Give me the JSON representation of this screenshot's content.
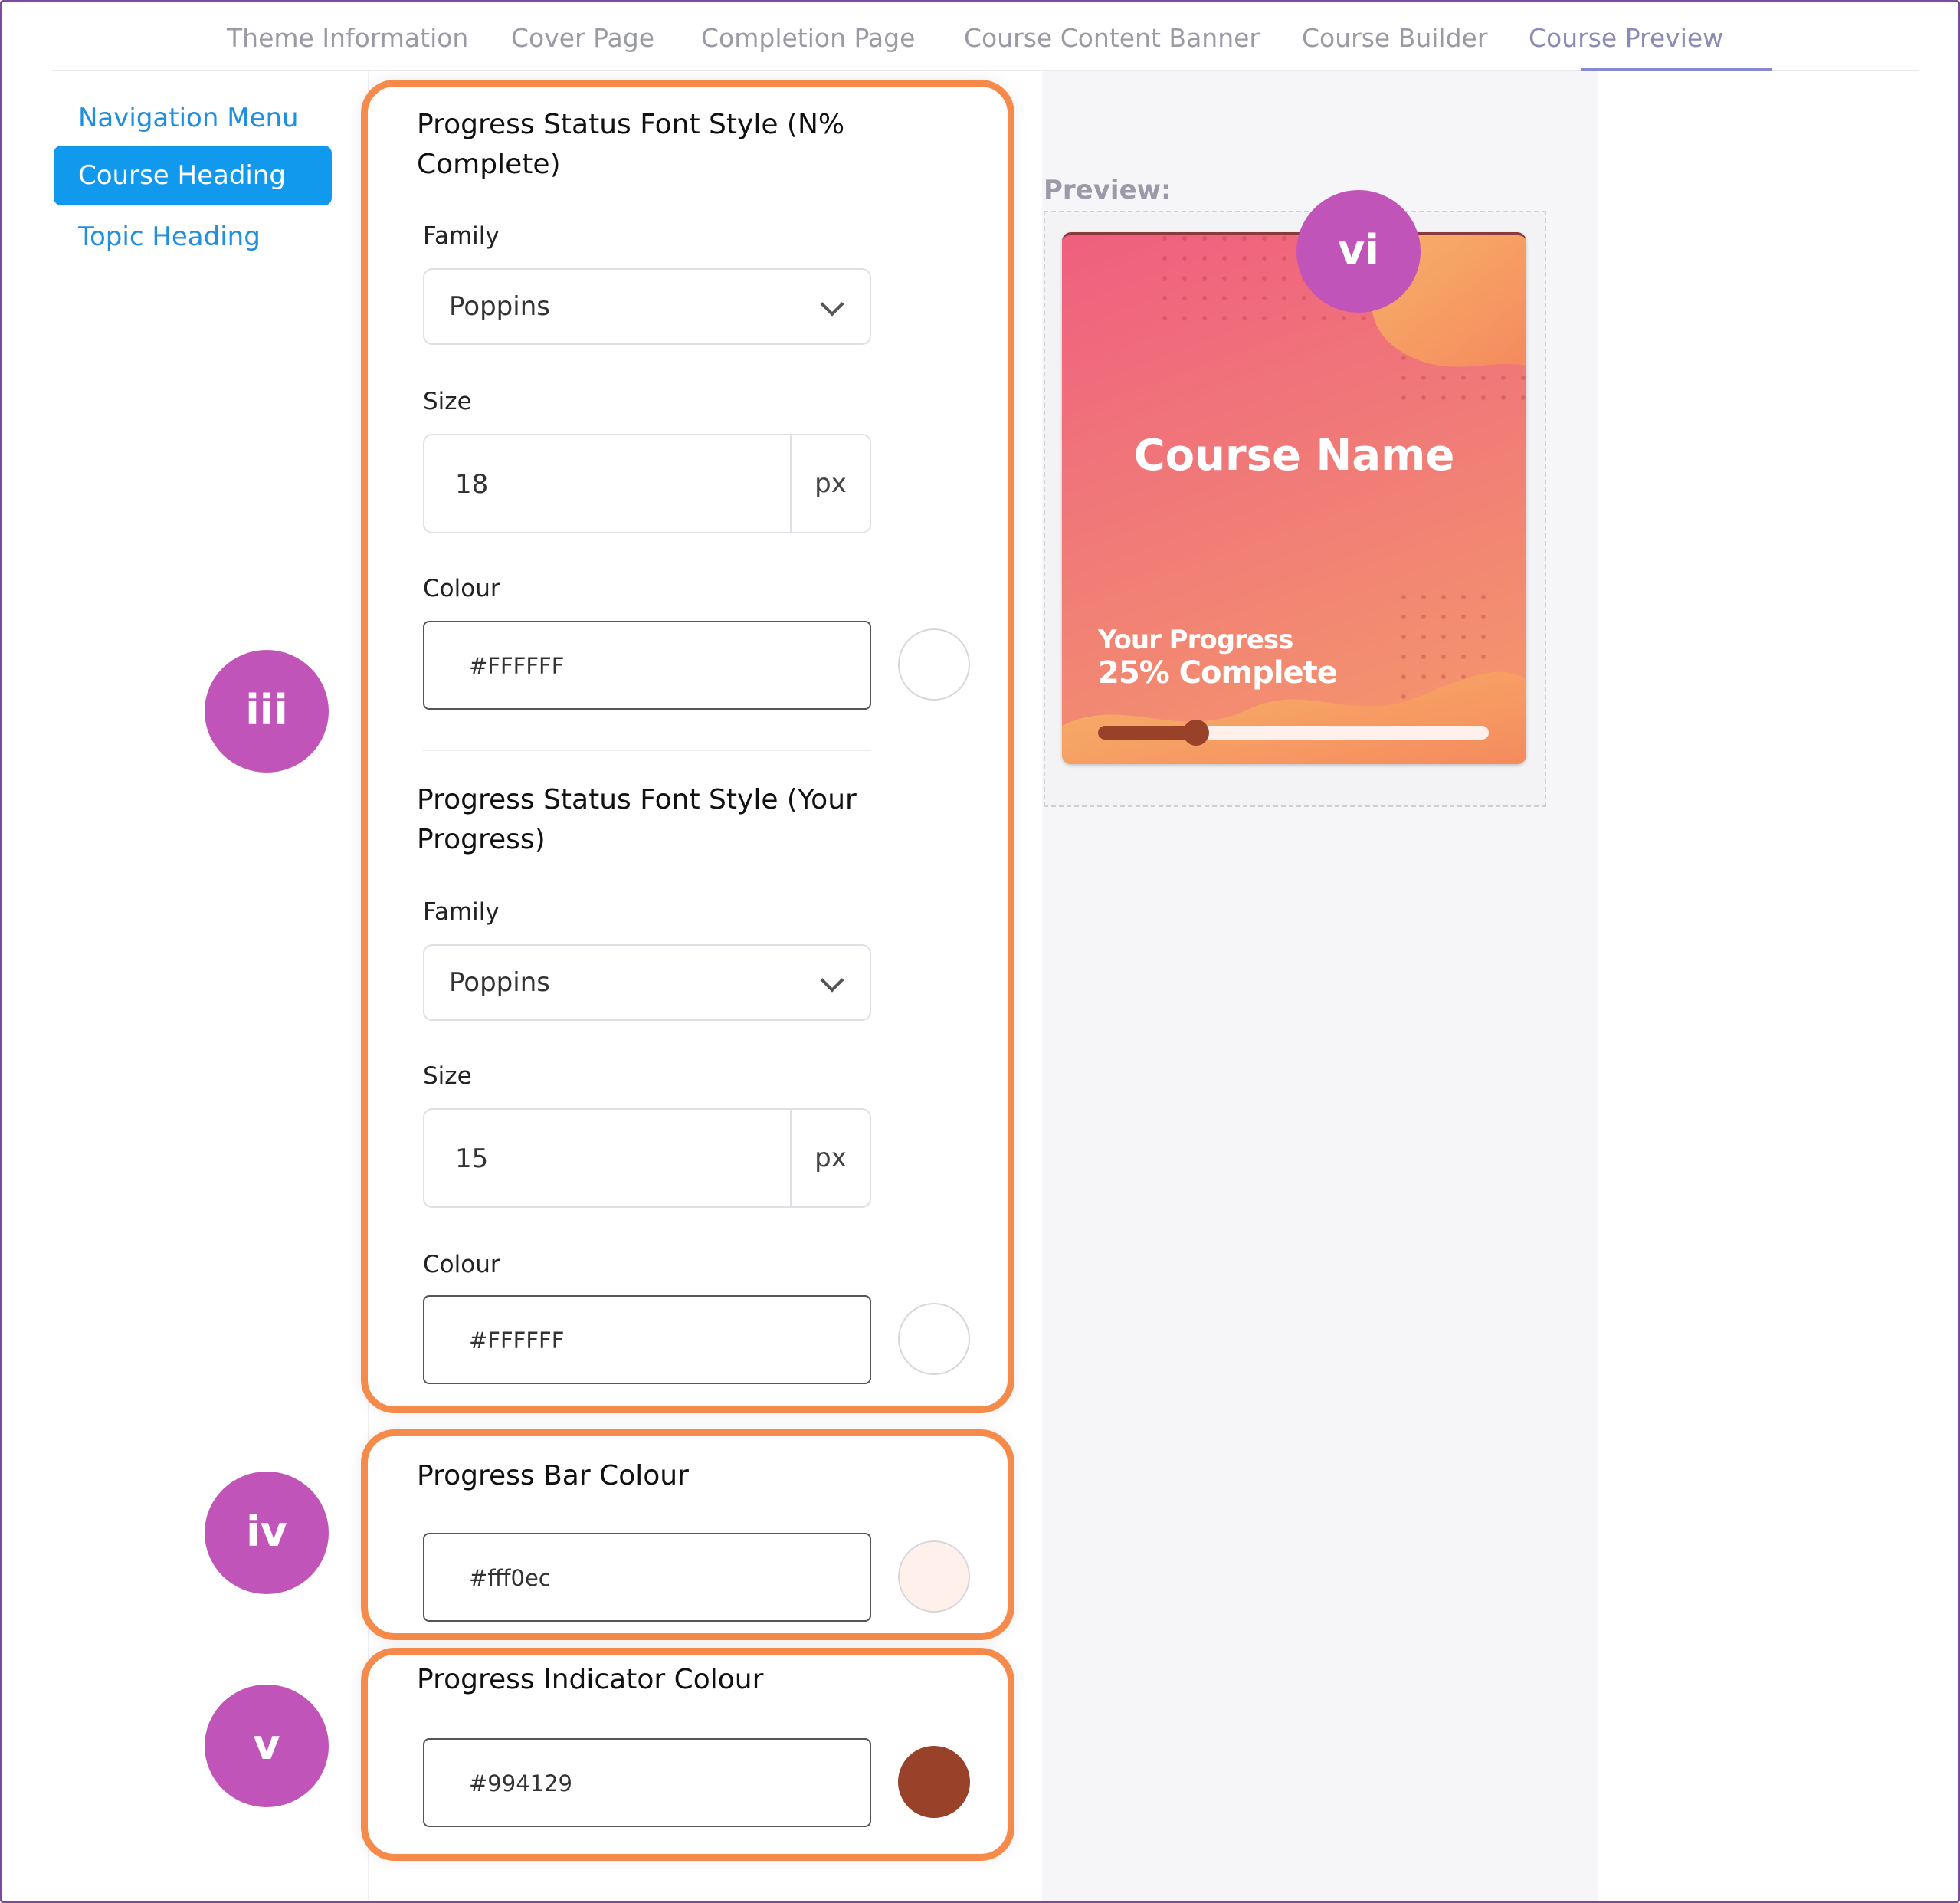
{
  "tabs": [
    {
      "label": "Theme Information"
    },
    {
      "label": "Cover Page"
    },
    {
      "label": "Completion Page"
    },
    {
      "label": "Course Content Banner"
    },
    {
      "label": "Course Builder"
    },
    {
      "label": "Course Preview",
      "active": true
    }
  ],
  "sidebar": {
    "items": [
      {
        "label": "Navigation Menu"
      },
      {
        "label": "Course Heading",
        "active": true
      },
      {
        "label": "Topic Heading"
      }
    ]
  },
  "progress_status_pct": {
    "title": "Progress Status Font Style (N% Complete)",
    "family_label": "Family",
    "family_value": "Poppins",
    "size_label": "Size",
    "size_value": "18",
    "size_unit": "px",
    "colour_label": "Colour",
    "colour_value": "#FFFFFF",
    "swatch_color": "#FFFFFF"
  },
  "progress_status_your": {
    "title": "Progress Status Font Style (Your Progress)",
    "family_label": "Family",
    "family_value": "Poppins",
    "size_label": "Size",
    "size_value": "15",
    "size_unit": "px",
    "colour_label": "Colour",
    "colour_value": "#FFFFFF",
    "swatch_color": "#FFFFFF"
  },
  "progress_bar": {
    "title": "Progress Bar Colour",
    "colour_value": "#fff0ec",
    "swatch_color": "#fff0ec"
  },
  "progress_indicator": {
    "title": "Progress Indicator Colour",
    "colour_value": "#994129",
    "swatch_color": "#994129"
  },
  "badges": {
    "iii": "iii",
    "iv": "iv",
    "v": "v",
    "vi": "vi"
  },
  "preview": {
    "label": "Preview:",
    "course_name": "Course Name",
    "your_progress": "Your Progress",
    "complete_text": "25% Complete",
    "progress_fraction": 0.25
  },
  "colors": {
    "accent": "#1199ee",
    "highlight_border": "#f58a4a",
    "badge": "#c154b8"
  }
}
